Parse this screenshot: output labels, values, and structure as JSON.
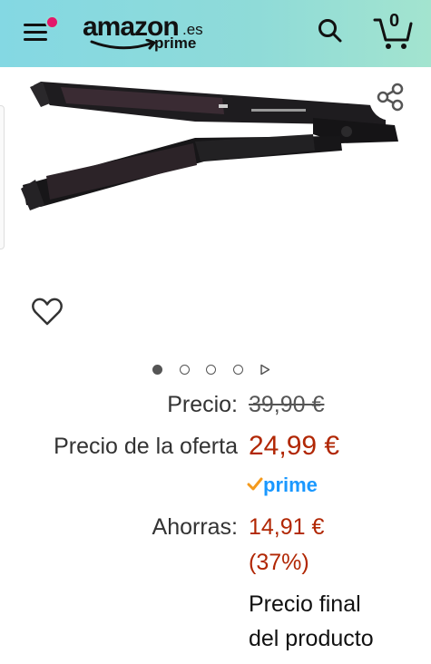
{
  "header": {
    "logo_word": "amazon",
    "logo_tld": ".es",
    "logo_prime": "prime",
    "cart_count": "0",
    "menu_notification_color": "#e3186a",
    "icons": [
      "menu-icon",
      "search-icon",
      "cart-icon"
    ]
  },
  "gallery": {
    "image_count": 4,
    "active_index": 0,
    "has_video": true,
    "icons": [
      "share-icon",
      "heart-icon",
      "play-icon"
    ]
  },
  "price": {
    "list_label": "Precio:",
    "list_value": "39,90 €",
    "deal_label": "Precio de la oferta",
    "deal_value": "24,99 €",
    "prime_label": "prime",
    "savings_label": "Ahorras:",
    "savings_value": "14,91 €",
    "savings_percent": "(37%)",
    "final_line1": "Precio final",
    "final_line2": "del producto"
  },
  "colors": {
    "header_gradient": [
      "#84d8e3",
      "#a3e4cf"
    ],
    "price_red": "#b12704",
    "prime_blue": "#1a98ff",
    "prime_check": "#f49a1d"
  }
}
